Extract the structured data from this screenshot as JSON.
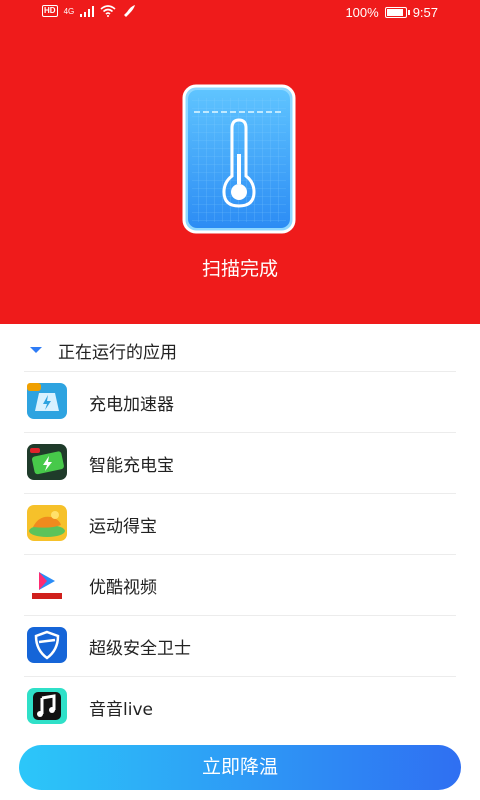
{
  "status_bar": {
    "network": "4G",
    "battery": "100%",
    "battery_level": 1.0,
    "time": "9:57"
  },
  "hero": {
    "scan_status": "扫描完成",
    "background_color": "#ef1b1b",
    "icon": "thermometer-icon"
  },
  "running_apps": {
    "header": "正在运行的应用",
    "items": [
      {
        "label": "充电加速器",
        "icon": "charge-accelerator-app-icon"
      },
      {
        "label": "智能充电宝",
        "icon": "smart-power-bank-app-icon"
      },
      {
        "label": "运动得宝",
        "icon": "sports-app-icon"
      },
      {
        "label": "优酷视频",
        "icon": "youku-video-app-icon"
      },
      {
        "label": "超级安全卫士",
        "icon": "security-guard-app-icon"
      },
      {
        "label": "音音live",
        "icon": "yinyin-live-app-icon"
      }
    ]
  },
  "action": {
    "cool_down_label": "立即降温",
    "accent_color": "#2f6ff2"
  }
}
